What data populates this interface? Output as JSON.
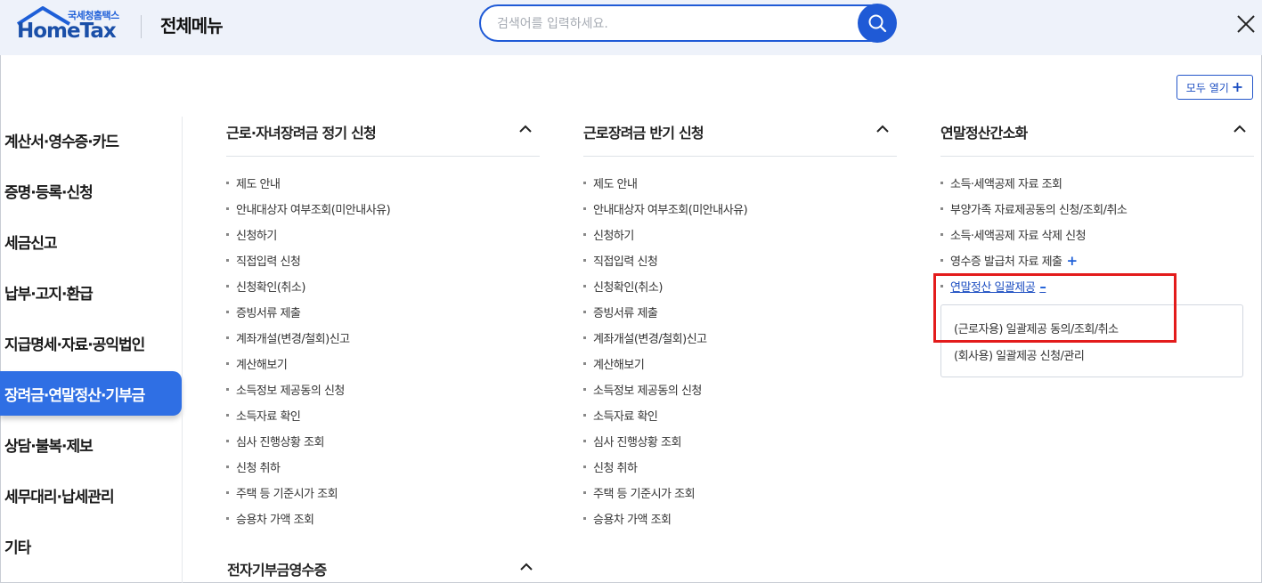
{
  "header": {
    "logo_small": "국세청홈택스",
    "logo_main": "HomeTax",
    "title": "전체메뉴",
    "search_placeholder": "검색어를 입력하세요."
  },
  "open_all_label": "모두 열기",
  "colors": {
    "accent": "#2f6fe4",
    "link": "#1e4fc2",
    "highlight": "#e31b1b",
    "header_bg": "#eef2fa"
  },
  "sidebar": {
    "items": [
      {
        "label": "계산서·영수증·카드",
        "active": false
      },
      {
        "label": "증명·등록·신청",
        "active": false
      },
      {
        "label": "세금신고",
        "active": false
      },
      {
        "label": "납부·고지·환급",
        "active": false
      },
      {
        "label": "지급명세·자료·공익법인",
        "active": false
      },
      {
        "label": "장려금·연말정산·기부금",
        "active": true
      },
      {
        "label": "상담·불복·제보",
        "active": false
      },
      {
        "label": "세무대리·납세관리",
        "active": false
      },
      {
        "label": "기타",
        "active": false
      }
    ]
  },
  "columns": [
    {
      "title": "근로·자녀장려금 정기 신청",
      "items": [
        "제도 안내",
        "안내대상자 여부조회(미안내사유)",
        "신청하기",
        "직접입력 신청",
        "신청확인(취소)",
        "증빙서류 제출",
        "계좌개설(변경/철회)신고",
        "계산해보기",
        "소득정보 제공동의 신청",
        "소득자료 확인",
        "심사 진행상황 조회",
        "신청 취하",
        "주택 등 기준시가 조회",
        "승용차 가액 조회"
      ]
    },
    {
      "title": "근로장려금 반기 신청",
      "items": [
        "제도 안내",
        "안내대상자 여부조회(미안내사유)",
        "신청하기",
        "직접입력 신청",
        "신청확인(취소)",
        "증빙서류 제출",
        "계좌개설(변경/철회)신고",
        "계산해보기",
        "소득정보 제공동의 신청",
        "소득자료 확인",
        "심사 진행상황 조회",
        "신청 취하",
        "주택 등 기준시가 조회",
        "승용차 가액 조회"
      ]
    },
    {
      "title": "연말정산간소화",
      "items": [
        "소득·세액공제 자료 조회",
        "부양가족 자료제공동의 신청/조회/취소",
        "소득·세액공제 자료 삭제 신청",
        "영수증 발급처 자료 제출",
        "연말정산 일괄제공"
      ],
      "item_addons": {
        "3": "+",
        "4": "–"
      },
      "sub_items": [
        "(근로자용) 일괄제공 동의/조회/취소",
        "(회사용) 일괄제공 신청/관리"
      ]
    }
  ],
  "bottom_section_title": "전자기부금영수증"
}
